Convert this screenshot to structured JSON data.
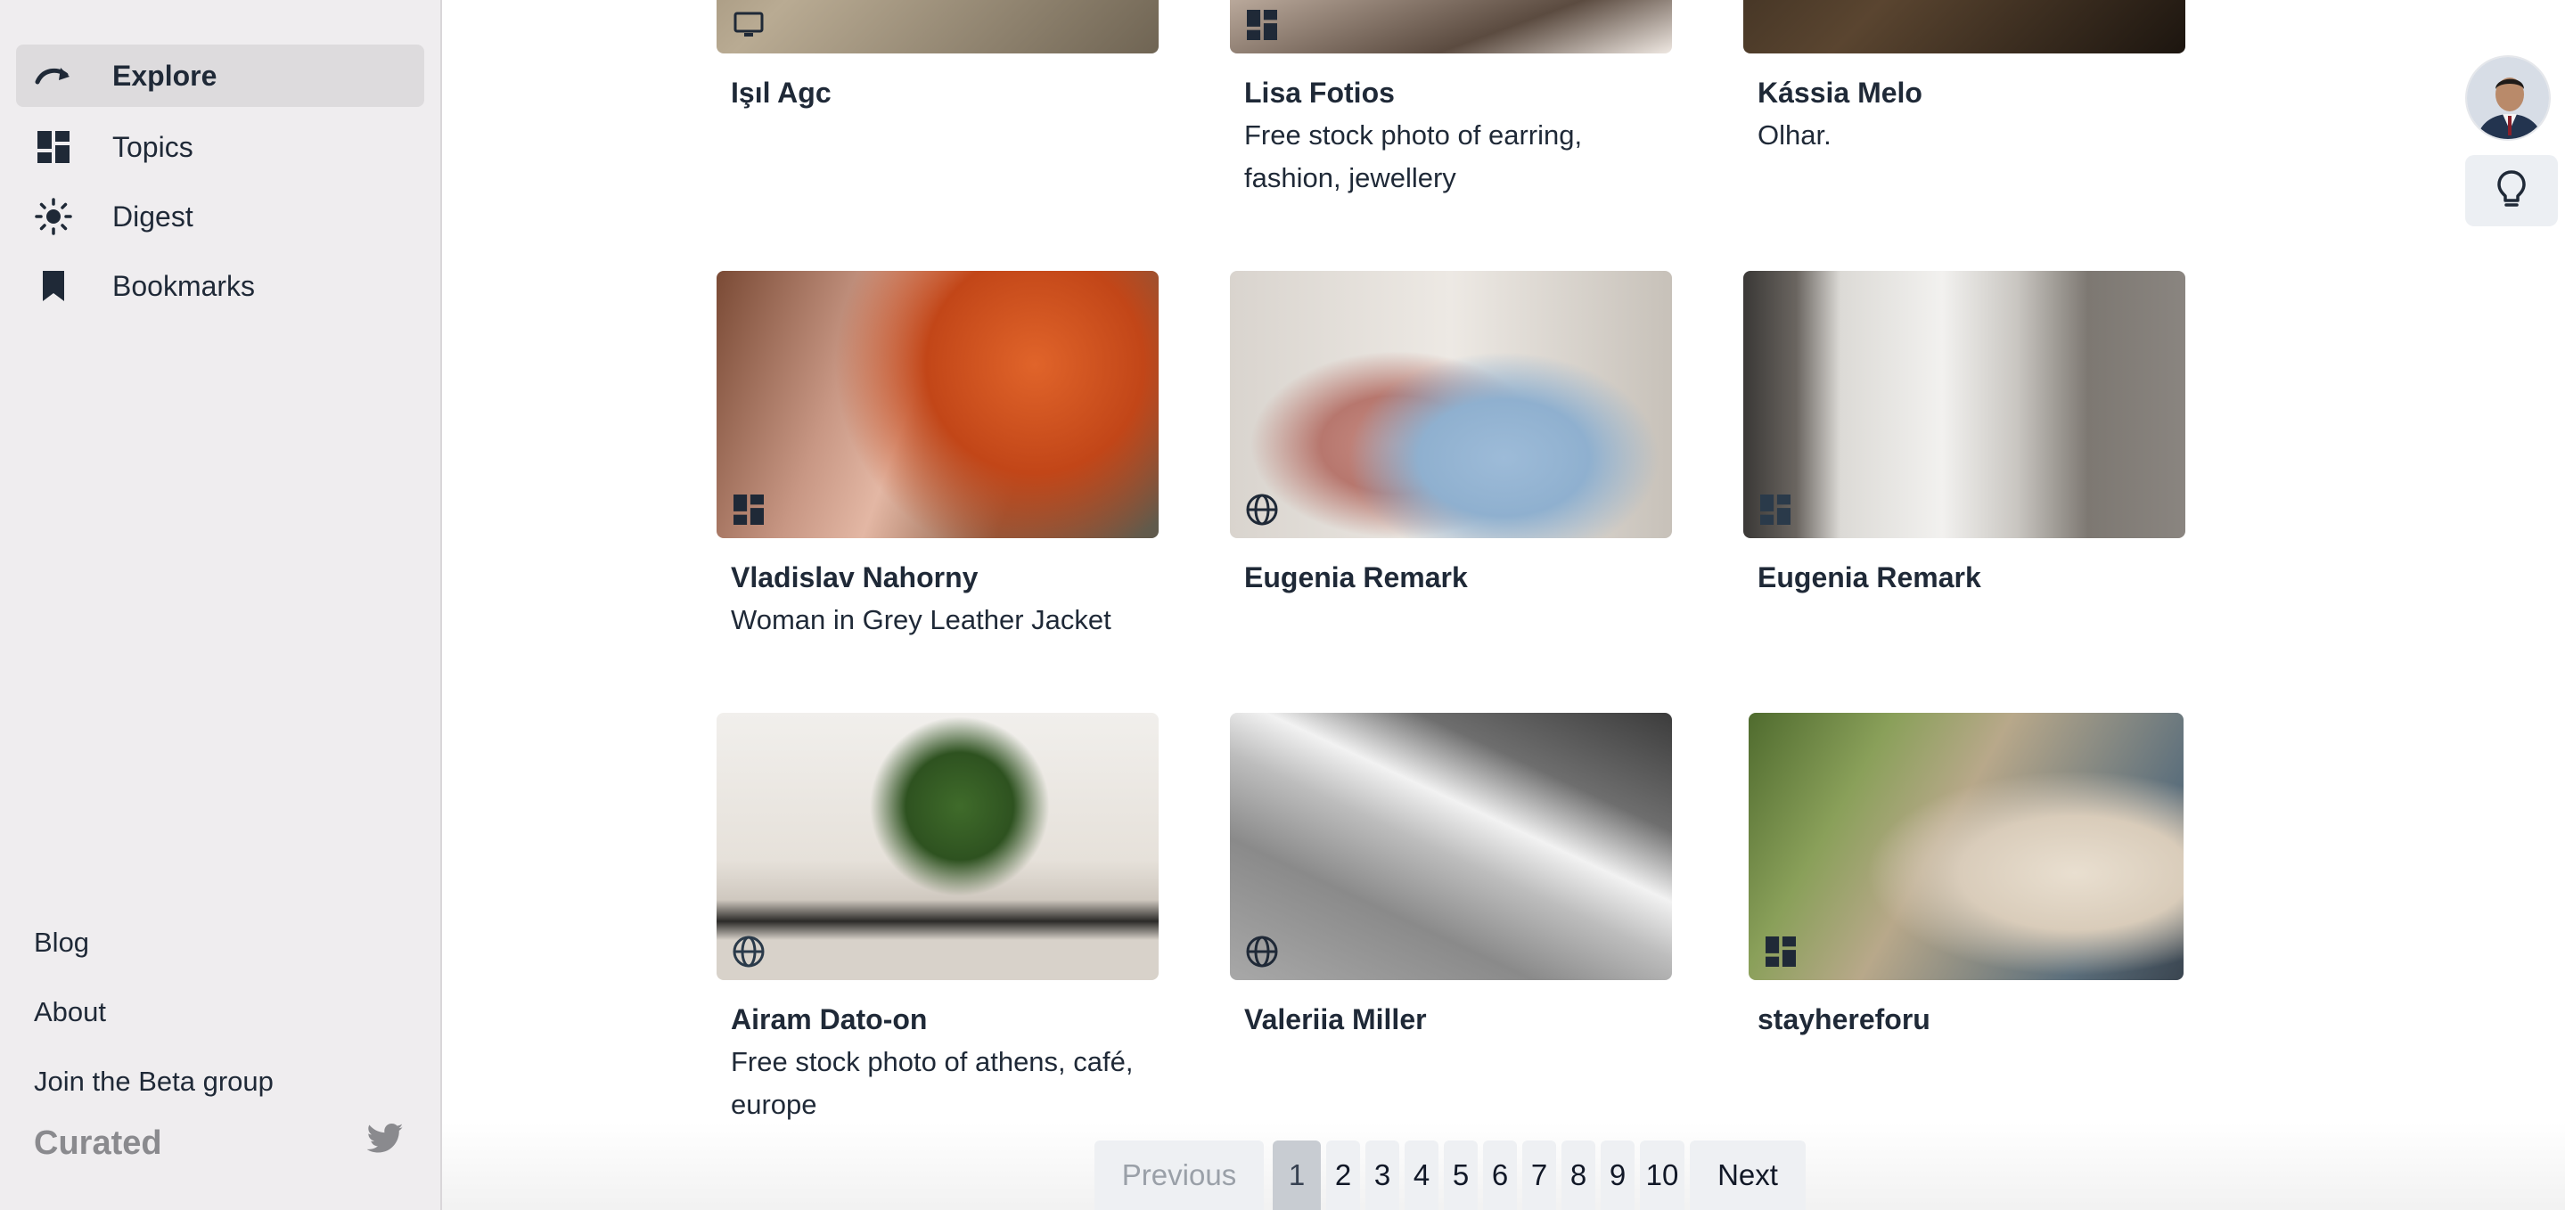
{
  "sidebar": {
    "nav": [
      {
        "label": "Explore",
        "icon": "explore-icon",
        "active": true
      },
      {
        "label": "Topics",
        "icon": "topics-icon",
        "active": false
      },
      {
        "label": "Digest",
        "icon": "sun-icon",
        "active": false
      },
      {
        "label": "Bookmarks",
        "icon": "bookmark-icon",
        "active": false
      }
    ],
    "footer": {
      "blog": "Blog",
      "about": "About",
      "beta": "Join the Beta group",
      "brand": "Curated"
    }
  },
  "cards": [
    {
      "author": "Işıl Agc",
      "description": "",
      "badge": "monitor-icon"
    },
    {
      "author": "Lisa Fotios",
      "description": "Free stock photo of earring, fashion, jewellery",
      "badge": "topics-icon"
    },
    {
      "author": "Kássia Melo",
      "description": "Olhar.",
      "badge": ""
    },
    {
      "author": "Vladislav Nahorny",
      "description": "Woman in Grey Leather Jacket",
      "badge": "topics-icon"
    },
    {
      "author": "Eugenia Remark",
      "description": "",
      "badge": "globe-icon"
    },
    {
      "author": "Eugenia Remark",
      "description": "",
      "badge": "topics-icon"
    },
    {
      "author": "Airam Dato-on",
      "description": "Free stock photo of athens, café, europe",
      "badge": "globe-icon"
    },
    {
      "author": "Valeriia Miller",
      "description": "",
      "badge": "globe-icon"
    },
    {
      "author": "stayhereforu",
      "description": "",
      "badge": "topics-icon"
    }
  ],
  "pagination": {
    "previous": "Previous",
    "next": "Next",
    "current": "1",
    "pages": [
      "1",
      "2",
      "3",
      "4",
      "5",
      "6",
      "7",
      "8",
      "9",
      "10"
    ]
  },
  "colors": {
    "sidebar_bg": "#efedef",
    "active_bg": "#dddbdd",
    "text": "#1f2937",
    "muted": "#8a8a8e"
  }
}
